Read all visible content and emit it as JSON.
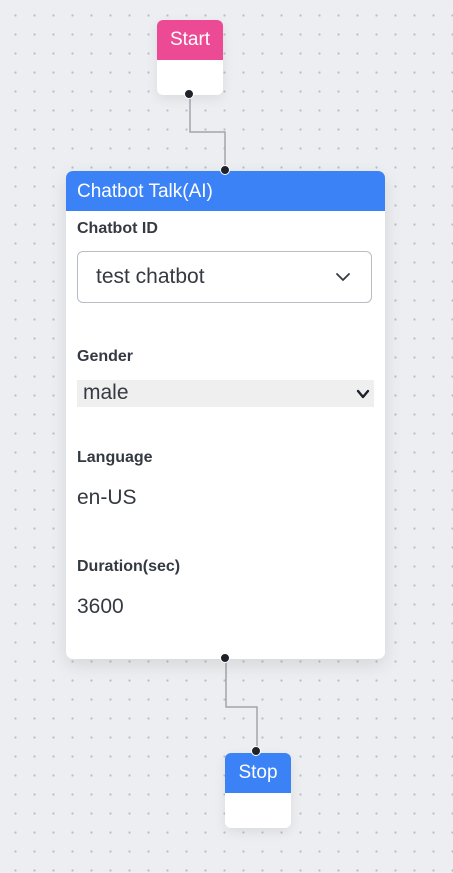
{
  "canvas": {
    "background": "#eceef1",
    "edge_color": "#a1a5ac"
  },
  "start_node": {
    "label": "Start",
    "color": "#ec4a94"
  },
  "chatbot_node": {
    "title": "Chatbot Talk(AI)",
    "color": "#3b82f6",
    "chatbot_id": {
      "label": "Chatbot ID",
      "value": "test chatbot",
      "icon": "chevron-down-icon"
    },
    "gender": {
      "label": "Gender",
      "value": "male",
      "icon": "chevron-down-icon"
    },
    "language": {
      "label": "Language",
      "value": "en-US"
    },
    "duration": {
      "label": "Duration(sec)",
      "value": "3600"
    }
  },
  "stop_node": {
    "label": "Stop",
    "color": "#3b82f6"
  }
}
